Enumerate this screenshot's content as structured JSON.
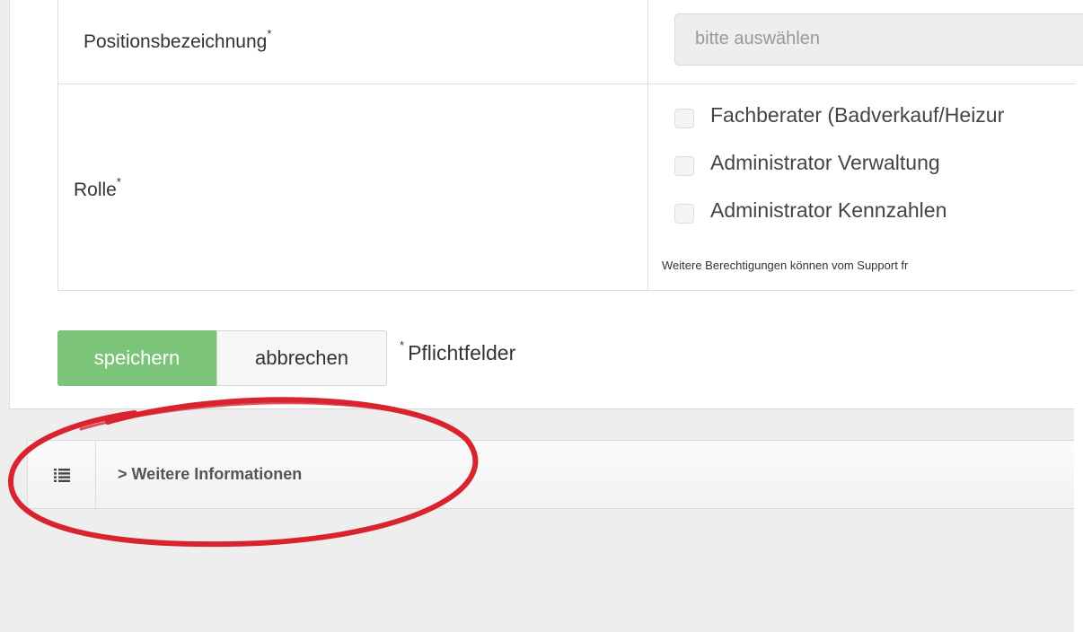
{
  "form": {
    "position_label": "Positionsbezeichnung",
    "position_required_mark": "*",
    "position_select_value": "bitte auswählen",
    "role_label": "Rolle",
    "role_required_mark": "*",
    "roles": [
      {
        "label": "Fachberater (Badverkauf/Heizur",
        "checked": false
      },
      {
        "label": "Administrator Verwaltung",
        "checked": false
      },
      {
        "label": "Administrator Kennzahlen",
        "checked": false
      }
    ],
    "roles_hint": "Weitere Berechtigungen können vom Support fr"
  },
  "actions": {
    "save_label": "speichern",
    "cancel_label": "abbrechen",
    "required_mark": "*",
    "required_note": "Pflichtfelder"
  },
  "info_bar": {
    "icon": "list-icon",
    "title": "> Weitere Informationen"
  },
  "colors": {
    "save_button": "#7cc47a",
    "annotation_circle": "#d9232e"
  }
}
